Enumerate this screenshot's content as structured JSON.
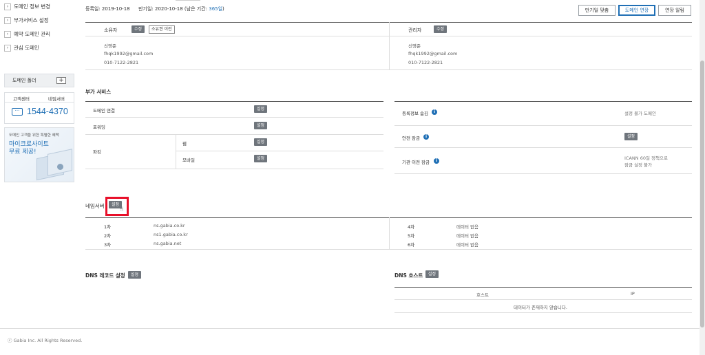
{
  "sidebar": {
    "menu": [
      {
        "label": "도메인 정보 변경"
      },
      {
        "label": "부가서비스 설정"
      },
      {
        "label": "예약 도메인 관리"
      },
      {
        "label": "관심 도메인"
      }
    ],
    "folder_label": "도메인 폴더",
    "folder_add": "+",
    "support_tabs": [
      "고객센터",
      "네임서버"
    ],
    "phone": "1544-4370",
    "promo_line1": "도메인 고객을 위한 특별한 혜택",
    "promo_line2": "마이크로사이트",
    "promo_line3": "무료 제공!"
  },
  "header": {
    "reg_label": "등록일:",
    "reg_date": "2019-10-18",
    "exp_label": "만기일:",
    "exp_date": "2020-10-18",
    "remaining_prefix": "(남은 기간:",
    "remaining_days": "365일",
    "remaining_suffix": ")",
    "buttons": [
      "만기일 맞춤",
      "도메인 연장",
      "연장 알림"
    ]
  },
  "owner": {
    "title": "소유자",
    "edit": "수정",
    "transfer": "소유권 이전",
    "name": "신영준",
    "email": "fhqk1992@gmail.com",
    "phone": "010-7122-2821"
  },
  "admin": {
    "title": "관리자",
    "edit": "수정",
    "name": "신영준",
    "email": "fhqk1992@gmail.com",
    "phone": "010-7122-2821"
  },
  "addons": {
    "title": "부가 서비스",
    "domain_connect": "도메인 연결",
    "forwarding": "포워딩",
    "parking": "파킹",
    "web": "웹",
    "mobile": "모바일",
    "set": "설정",
    "privacy_label": "등록정보 숨김",
    "privacy_value": "설정 불가 도메인",
    "safe_lock_label": "안전 잠금",
    "agency_lock_label": "기관 이전 잠금",
    "agency_lock_value1": "ICANN 60일 정책으로",
    "agency_lock_value2": "잠금 설정 불가"
  },
  "nameservers": {
    "title": "네임서버",
    "set": "설정",
    "rows_left": [
      {
        "order": "1차",
        "host": "ns.gabia.co.kr"
      },
      {
        "order": "2차",
        "host": "ns1.gabia.co.kr"
      },
      {
        "order": "3차",
        "host": "ns.gabia.net"
      }
    ],
    "rows_right": [
      {
        "order": "4차",
        "host": "데이터 없음"
      },
      {
        "order": "5차",
        "host": "데이터 없음"
      },
      {
        "order": "6차",
        "host": "데이터 없음"
      }
    ]
  },
  "dns": {
    "record_title": "DNS 레코드 설정",
    "host_title": "DNS 호스트",
    "set": "설정",
    "col_host": "호스트",
    "col_ip": "IP",
    "empty": "데이터가 존재하지 않습니다."
  },
  "footer": {
    "copyright": "ⓒ Gabia Inc. All Rights Reserved."
  },
  "colors": {
    "accent_blue": "#1f6fb5",
    "gray_button": "#6f757c",
    "highlight_red": "#e8102a"
  }
}
